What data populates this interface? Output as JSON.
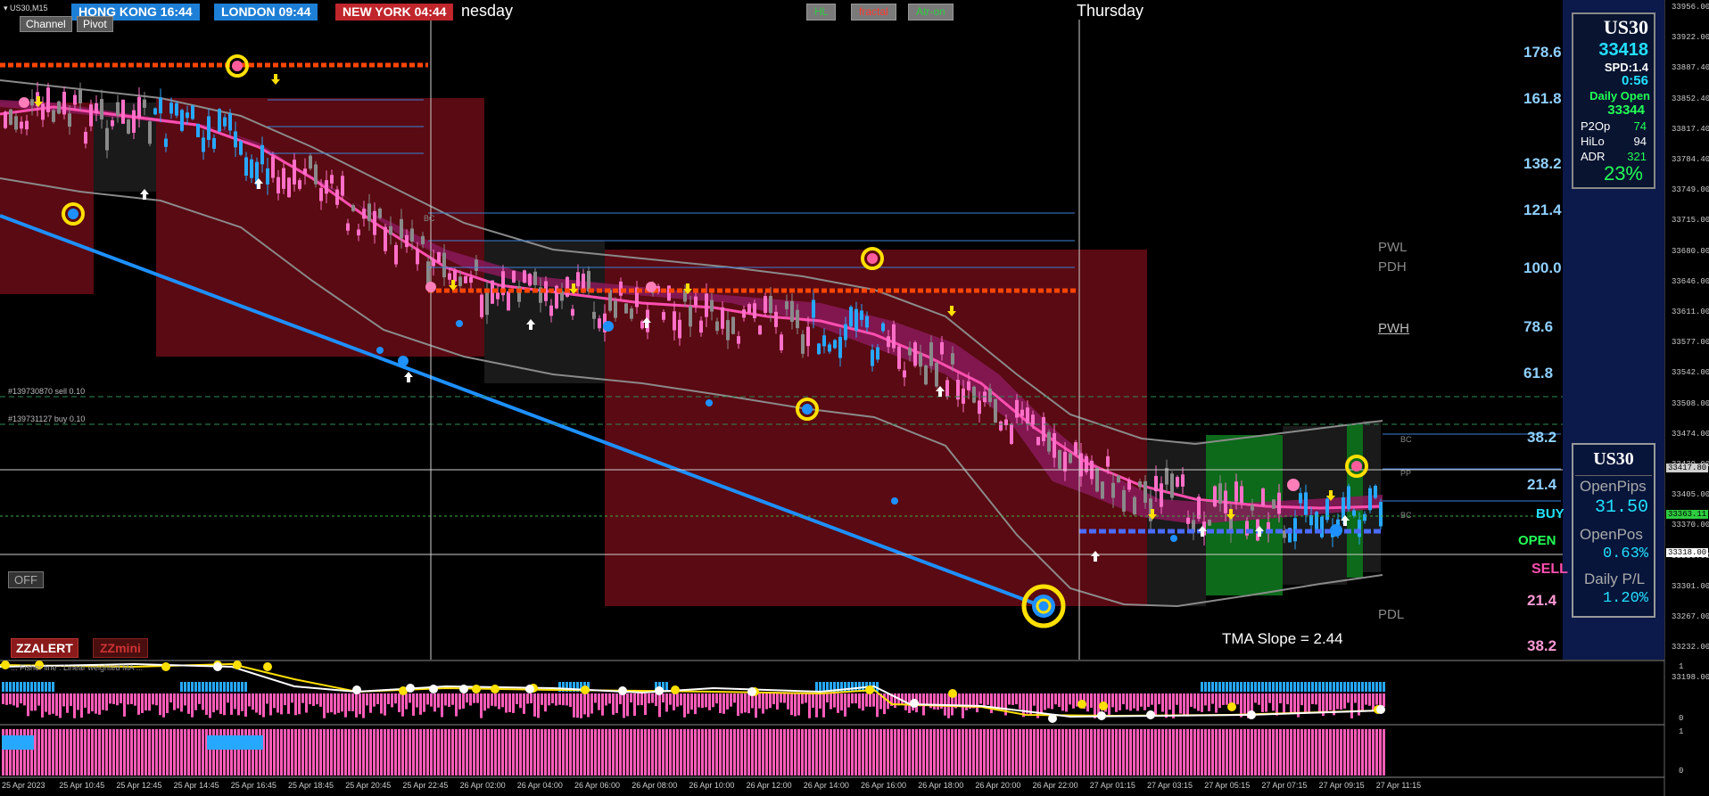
{
  "window": {
    "symbol_timeframe": "US30,M15"
  },
  "sessions": [
    {
      "label": "HONG KONG 16:44",
      "color": "#1e7fd6"
    },
    {
      "label": "LONDON  09:44",
      "color": "#1e7fd6"
    },
    {
      "label": "NEW YORK  04:44",
      "color": "#c0262c"
    }
  ],
  "buttons": {
    "channel": "Channel",
    "pivot": "Pivot",
    "hl": "HL",
    "fractal": "fractal",
    "atr": "Atr-on",
    "off": "OFF",
    "zzalert": "ZZALERT",
    "zzmini": "ZZmini"
  },
  "days": {
    "wednesday": "nesday",
    "thursday": "Thursday"
  },
  "orders": {
    "sell": "#139730870 sell 0.10",
    "buy": "#139731127 buy 0.10"
  },
  "fibo_levels": [
    "178.6",
    "161.8",
    "138.2",
    "121.4",
    "100.0",
    "78.6",
    "61.8",
    "38.2",
    "21.4",
    "21.4",
    "38.2"
  ],
  "signals": {
    "buy": "BUY",
    "open": "OPEN",
    "sell": "SELL"
  },
  "pivot_labels": {
    "pwl": "PWL",
    "pdh": "PDH",
    "pwh": "PWH",
    "pdl": "PDL",
    "bc_top": "BC",
    "pp": "PP",
    "bc_mid": "BC",
    "bc_left": "BC"
  },
  "tma_slope": "TMA Slope = 2.44",
  "info_panel": {
    "symbol": "US30",
    "price": "33418",
    "spread": "SPD:1.4",
    "timer": "0:56",
    "daily_open_label": "Daily Open",
    "daily_open": "33344",
    "rows": [
      {
        "label": "P2Op",
        "value": "74"
      },
      {
        "label": "HiLo",
        "value": "94"
      },
      {
        "label": "ADR",
        "value": "321"
      }
    ],
    "percent": "23%"
  },
  "pl_panel": {
    "symbol": "US30",
    "open_pips_label": "OpenPips",
    "open_pips": "31.50",
    "open_pos_label": "OpenPos",
    "open_pos": "0.63%",
    "daily_pl_label": "Daily P/L",
    "daily_pl": "1.20%"
  },
  "price_axis": [
    "33956.00",
    "33922.00",
    "33887.40",
    "33852.40",
    "33817.40",
    "33784.40",
    "33749.00",
    "33715.00",
    "33680.00",
    "33646.00",
    "33611.00",
    "33577.00",
    "33542.00",
    "33508.00",
    "33474.00",
    "33439.00",
    "33405.00",
    "33370.00",
    "33336.00",
    "33301.00",
    "33267.00",
    "33232.00",
    "33198.00"
  ],
  "price_tags": {
    "bid": "33417.80",
    "buy_line": "33363.11",
    "sell_line": "33318.00"
  },
  "osc_axis": {
    "top": "1",
    "bottom": "0",
    "top2": "1",
    "bottom2": "0"
  },
  "osc1_label": "... Fisher line : Linear weighted MA ...",
  "time_axis": [
    "25 Apr 2023",
    "25 Apr 10:45",
    "25 Apr 12:45",
    "25 Apr 14:45",
    "25 Apr 16:45",
    "25 Apr 18:45",
    "25 Apr 20:45",
    "25 Apr 22:45",
    "26 Apr 02:00",
    "26 Apr 04:00",
    "26 Apr 06:00",
    "26 Apr 08:00",
    "26 Apr 10:00",
    "26 Apr 12:00",
    "26 Apr 14:00",
    "26 Apr 16:00",
    "26 Apr 18:00",
    "26 Apr 20:00",
    "26 Apr 22:00",
    "27 Apr 01:15",
    "27 Apr 03:15",
    "27 Apr 05:15",
    "27 Apr 07:15",
    "27 Apr 09:15",
    "27 Apr 11:15"
  ],
  "colors": {
    "band": "#5a0a12",
    "tma": "#ff4fb0",
    "channel": "#1e90ff",
    "pivot": "#ff4500"
  }
}
